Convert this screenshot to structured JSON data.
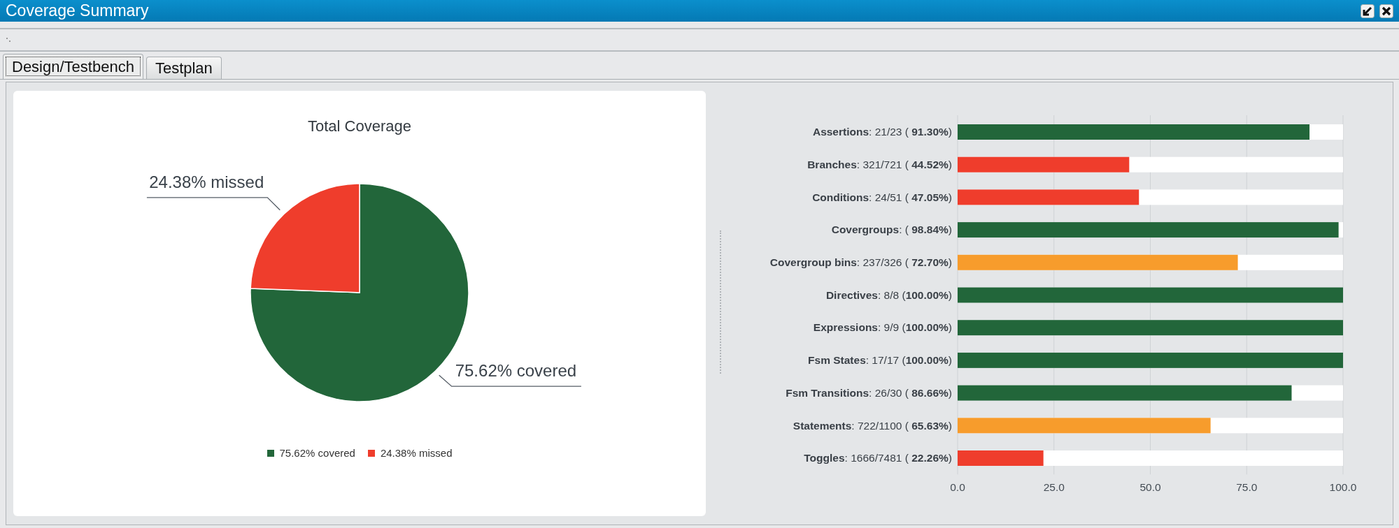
{
  "window": {
    "title": "Coverage Summary"
  },
  "tabs": [
    {
      "label": "Design/Testbench",
      "selected": true
    },
    {
      "label": "Testplan",
      "selected": false
    }
  ],
  "pie_panel": {
    "chart_data": {
      "type": "pie",
      "title": "Total Coverage",
      "categories": [
        "75.62% covered",
        "24.38% missed"
      ],
      "values": [
        75.62,
        24.38
      ],
      "colors": [
        "#22663a",
        "#ef3d2c"
      ],
      "value_labels": [
        "75.62% covered",
        "24.38% missed"
      ]
    }
  },
  "bar_panel": {
    "chart_data": {
      "type": "bar",
      "orientation": "horizontal",
      "categories": [
        "**Assertions**: 21/23 ( **91.30%**)",
        "**Branches**: 321/721 ( **44.52%**)",
        "**Conditions**: 24/51 ( **47.05%**)",
        "**Covergroups**: ( **98.84%**)",
        "**Covergroup bins**: 237/326 ( **72.70%**)",
        "**Directives**: 8/8 (**100.00%**)",
        "**Expressions**: 9/9 (**100.00%**)",
        "**Fsm States**: 17/17 (**100.00%**)",
        "**Fsm Transitions**: 26/30 ( **86.66%**)",
        "**Statements**: 722/1100 ( **65.63%**)",
        "**Toggles**: 1666/7481 ( **22.26%**)"
      ],
      "values": [
        91.3,
        44.52,
        47.05,
        98.84,
        72.7,
        100,
        100,
        100,
        86.66,
        65.63,
        22.26
      ],
      "colors": [
        "#22663a",
        "#ef3d2c",
        "#ef3d2c",
        "#22663a",
        "#f79c2c",
        "#22663a",
        "#22663a",
        "#22663a",
        "#22663a",
        "#f79c2c",
        "#ef3d2c"
      ],
      "xlim": [
        0,
        100
      ],
      "grid": true,
      "xticks": [
        {
          "value": 0,
          "label": "0.0"
        },
        {
          "value": 25,
          "label": "25.0"
        },
        {
          "value": 50,
          "label": "50.0"
        },
        {
          "value": 75,
          "label": "75.0"
        },
        {
          "value": 100,
          "label": "100.0"
        }
      ]
    }
  }
}
